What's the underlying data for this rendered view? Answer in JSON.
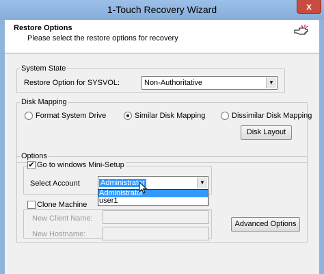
{
  "window": {
    "title": "1-Touch Recovery Wizard",
    "close_glyph": "x"
  },
  "header": {
    "title": "Restore Options",
    "subtitle": "Please select the restore options for recovery",
    "icon": "hand-pointer-icon"
  },
  "system_state": {
    "label": "System State",
    "option_label": "Restore Option for SYSVOL:",
    "option_value": "Non-Authoritative"
  },
  "disk_mapping": {
    "label": "Disk Mapping",
    "options": [
      "Format System Drive",
      "Similar Disk Mapping",
      "Dissimilar Disk Mapping"
    ],
    "selected": "Similar Disk Mapping",
    "disk_layout_button": "Disk Layout"
  },
  "options": {
    "label": "Options",
    "mini_setup_label": "Go to windows Mini-Setup",
    "mini_setup_checked": true,
    "select_account_label": "Select Account",
    "account_value": "Administrator",
    "account_options": [
      "Administrator",
      "user1"
    ],
    "clone_label": "Clone Machine",
    "clone_checked": false,
    "client_name_label": "New Client Name:",
    "hostname_label": "New Hostname:",
    "advanced_button": "Advanced Options"
  },
  "colors": {
    "title_bar": "#8fb4dc",
    "close_button": "#c74b3f",
    "selection": "#3399ff"
  }
}
